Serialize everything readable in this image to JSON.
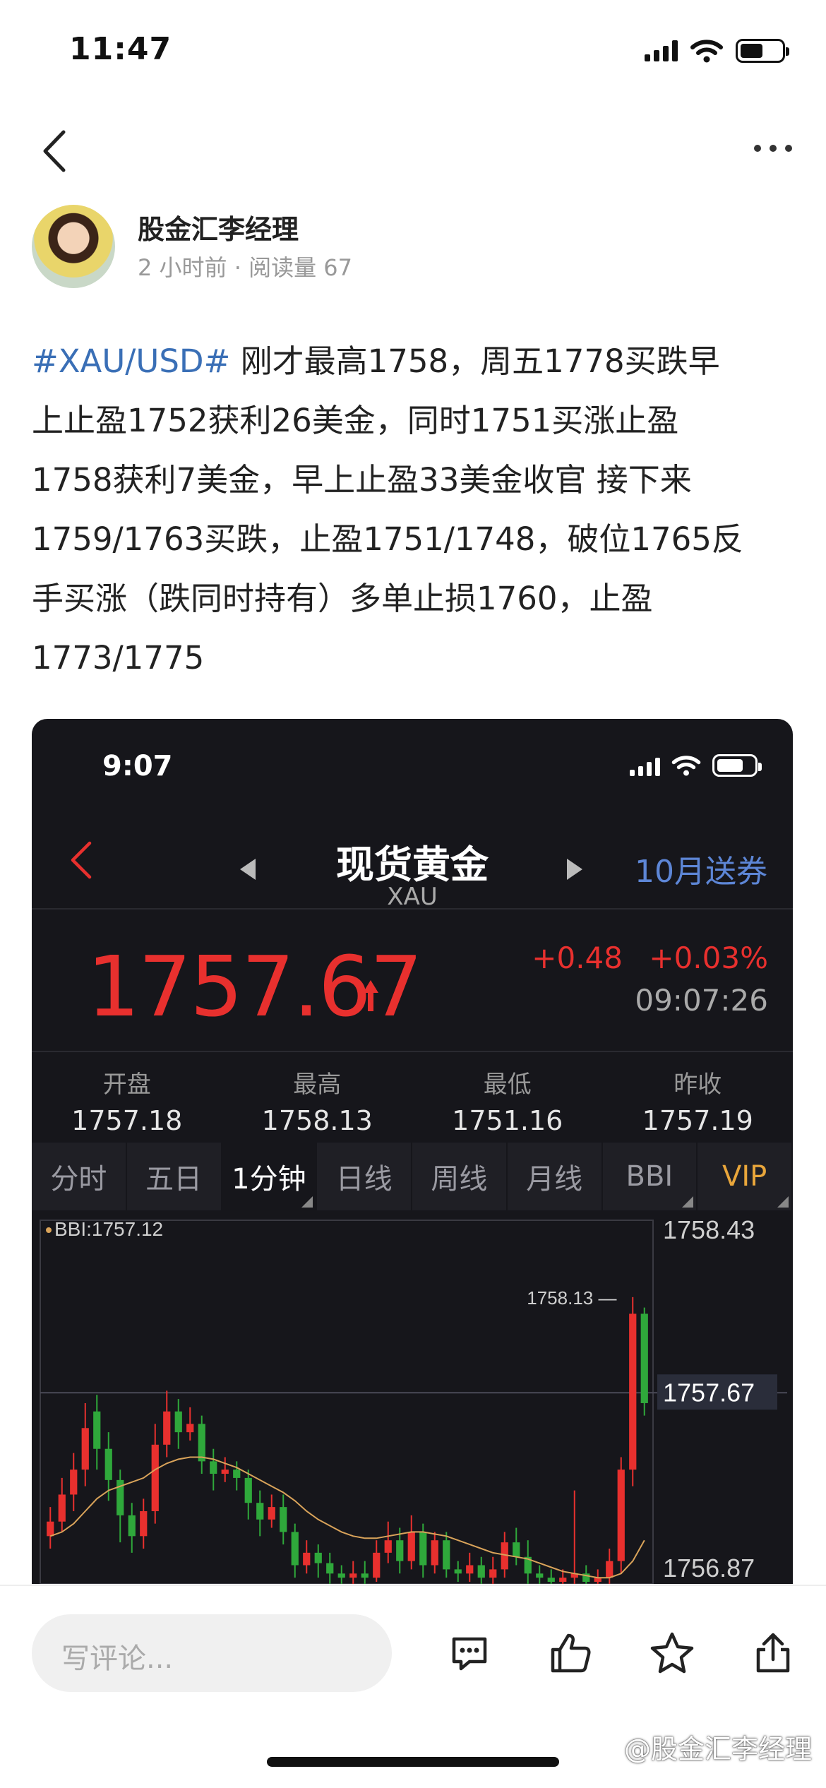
{
  "status_bar": {
    "time": "11:47",
    "icons": [
      "signal-icon",
      "wifi-icon",
      "battery-icon"
    ]
  },
  "nav": {
    "icons": [
      "back-arrow-icon",
      "more-icon"
    ]
  },
  "author": {
    "name": "股金汇李经理",
    "time_ago": "2 小时前",
    "separator": "·",
    "read_label": "阅读量",
    "read_count": "67"
  },
  "post": {
    "tag": "#XAU/USD#",
    "lines": [
      " 刚才最高1758，周五1778买跌早",
      "上止盈1752获利26美金，同时1751买涨止盈",
      "1758获利7美金，早上止盈33美金收官 接下来",
      "1759/1763买跌，止盈1751/1748，破位1765反",
      "手买涨（跌同时持有）多单止损1760，止盈",
      "1773/1775"
    ]
  },
  "screenshot": {
    "time": "9:07",
    "title": "现货黄金",
    "symbol": "XAU",
    "promo": "10月送券",
    "price": "1757.67",
    "change": "+0.48",
    "change_pct": "+0.03%",
    "clock": "09:07:26",
    "stats": [
      {
        "label": "开盘",
        "value": "1757.18"
      },
      {
        "label": "最高",
        "value": "1758.13"
      },
      {
        "label": "最低",
        "value": "1751.16"
      },
      {
        "label": "昨收",
        "value": "1757.19"
      }
    ],
    "tabs": [
      "分时",
      "五日",
      "1分钟",
      "日线",
      "周线",
      "月线",
      "BBI",
      "VIP"
    ],
    "active_tab": "1分钟",
    "colors": {
      "up": "#e8302e",
      "down": "#2fa83b",
      "bbi": "#d9a35a",
      "link": "#5d86d6",
      "vip": "#e9a63b"
    }
  },
  "chart_data": {
    "type": "candlestick",
    "indicator_label": "BBI:1757.12",
    "y_ticks": [
      "1758.43",
      "1757.67",
      "1756.87"
    ],
    "ylim": [
      1756.75,
      1758.5
    ],
    "high_label": "1758.13",
    "current_label": "1757.67",
    "candles": [
      {
        "o": 1756.98,
        "c": 1757.05,
        "h": 1757.12,
        "l": 1756.92
      },
      {
        "o": 1757.05,
        "c": 1757.18,
        "h": 1757.26,
        "l": 1757.0
      },
      {
        "o": 1757.18,
        "c": 1757.3,
        "h": 1757.38,
        "l": 1757.1
      },
      {
        "o": 1757.3,
        "c": 1757.5,
        "h": 1757.62,
        "l": 1757.22
      },
      {
        "o": 1757.58,
        "c": 1757.4,
        "h": 1757.66,
        "l": 1757.3
      },
      {
        "o": 1757.4,
        "c": 1757.25,
        "h": 1757.48,
        "l": 1757.15
      },
      {
        "o": 1757.25,
        "c": 1757.08,
        "h": 1757.3,
        "l": 1756.95
      },
      {
        "o": 1757.08,
        "c": 1756.98,
        "h": 1757.14,
        "l": 1756.9
      },
      {
        "o": 1756.98,
        "c": 1757.1,
        "h": 1757.16,
        "l": 1756.92
      },
      {
        "o": 1757.1,
        "c": 1757.42,
        "h": 1757.52,
        "l": 1757.04
      },
      {
        "o": 1757.42,
        "c": 1757.58,
        "h": 1757.68,
        "l": 1757.36
      },
      {
        "o": 1757.58,
        "c": 1757.48,
        "h": 1757.64,
        "l": 1757.4
      },
      {
        "o": 1757.48,
        "c": 1757.52,
        "h": 1757.6,
        "l": 1757.44
      },
      {
        "o": 1757.52,
        "c": 1757.34,
        "h": 1757.56,
        "l": 1757.28
      },
      {
        "o": 1757.34,
        "c": 1757.28,
        "h": 1757.4,
        "l": 1757.2
      },
      {
        "o": 1757.28,
        "c": 1757.3,
        "h": 1757.36,
        "l": 1757.24
      },
      {
        "o": 1757.3,
        "c": 1757.26,
        "h": 1757.34,
        "l": 1757.2
      },
      {
        "o": 1757.26,
        "c": 1757.14,
        "h": 1757.3,
        "l": 1757.06
      },
      {
        "o": 1757.14,
        "c": 1757.06,
        "h": 1757.2,
        "l": 1756.98
      },
      {
        "o": 1757.06,
        "c": 1757.12,
        "h": 1757.18,
        "l": 1757.02
      },
      {
        "o": 1757.12,
        "c": 1757.0,
        "h": 1757.18,
        "l": 1756.94
      },
      {
        "o": 1757.0,
        "c": 1756.84,
        "h": 1757.04,
        "l": 1756.78
      },
      {
        "o": 1756.84,
        "c": 1756.9,
        "h": 1756.96,
        "l": 1756.8
      },
      {
        "o": 1756.9,
        "c": 1756.85,
        "h": 1756.94,
        "l": 1756.78
      },
      {
        "o": 1756.85,
        "c": 1756.8,
        "h": 1756.9,
        "l": 1756.75
      },
      {
        "o": 1756.8,
        "c": 1756.78,
        "h": 1756.84,
        "l": 1756.75
      },
      {
        "o": 1756.78,
        "c": 1756.8,
        "h": 1756.86,
        "l": 1756.75
      },
      {
        "o": 1756.8,
        "c": 1756.78,
        "h": 1756.86,
        "l": 1756.75
      },
      {
        "o": 1756.78,
        "c": 1756.9,
        "h": 1756.96,
        "l": 1756.76
      },
      {
        "o": 1756.9,
        "c": 1756.96,
        "h": 1757.05,
        "l": 1756.85
      },
      {
        "o": 1756.96,
        "c": 1756.86,
        "h": 1757.02,
        "l": 1756.8
      },
      {
        "o": 1756.86,
        "c": 1757.0,
        "h": 1757.08,
        "l": 1756.82
      },
      {
        "o": 1757.0,
        "c": 1756.84,
        "h": 1757.04,
        "l": 1756.78
      },
      {
        "o": 1756.84,
        "c": 1756.96,
        "h": 1757.0,
        "l": 1756.8
      },
      {
        "o": 1756.96,
        "c": 1756.82,
        "h": 1757.0,
        "l": 1756.78
      },
      {
        "o": 1756.82,
        "c": 1756.8,
        "h": 1756.86,
        "l": 1756.76
      },
      {
        "o": 1756.8,
        "c": 1756.84,
        "h": 1756.9,
        "l": 1756.76
      },
      {
        "o": 1756.84,
        "c": 1756.78,
        "h": 1756.88,
        "l": 1756.75
      },
      {
        "o": 1756.78,
        "c": 1756.82,
        "h": 1756.88,
        "l": 1756.75
      },
      {
        "o": 1756.82,
        "c": 1756.95,
        "h": 1757.0,
        "l": 1756.78
      },
      {
        "o": 1756.95,
        "c": 1756.88,
        "h": 1757.02,
        "l": 1756.84
      },
      {
        "o": 1756.88,
        "c": 1756.8,
        "h": 1756.96,
        "l": 1756.75
      },
      {
        "o": 1756.8,
        "c": 1756.78,
        "h": 1756.84,
        "l": 1756.75
      },
      {
        "o": 1756.78,
        "c": 1756.76,
        "h": 1756.82,
        "l": 1756.75
      },
      {
        "o": 1756.76,
        "c": 1756.78,
        "h": 1756.82,
        "l": 1756.75
      },
      {
        "o": 1756.78,
        "c": 1756.8,
        "h": 1757.2,
        "l": 1756.75
      },
      {
        "o": 1756.8,
        "c": 1756.76,
        "h": 1756.84,
        "l": 1756.75
      },
      {
        "o": 1756.76,
        "c": 1756.78,
        "h": 1756.82,
        "l": 1756.75
      },
      {
        "o": 1756.78,
        "c": 1756.86,
        "h": 1756.92,
        "l": 1756.75
      },
      {
        "o": 1756.86,
        "c": 1757.3,
        "h": 1757.36,
        "l": 1756.8
      },
      {
        "o": 1757.3,
        "c": 1758.05,
        "h": 1758.13,
        "l": 1757.22
      },
      {
        "o": 1758.05,
        "c": 1757.62,
        "h": 1758.08,
        "l": 1757.56
      }
    ],
    "bbi": [
      1756.98,
      1757.0,
      1757.04,
      1757.1,
      1757.16,
      1757.2,
      1757.22,
      1757.24,
      1757.26,
      1757.3,
      1757.33,
      1757.35,
      1757.36,
      1757.36,
      1757.35,
      1757.33,
      1757.31,
      1757.28,
      1757.25,
      1757.22,
      1757.19,
      1757.15,
      1757.1,
      1757.06,
      1757.03,
      1757.0,
      1756.98,
      1756.97,
      1756.97,
      1756.98,
      1756.99,
      1757.0,
      1757.0,
      1756.99,
      1756.98,
      1756.96,
      1756.94,
      1756.92,
      1756.9,
      1756.89,
      1756.88,
      1756.87,
      1756.85,
      1756.83,
      1756.81,
      1756.8,
      1756.79,
      1756.78,
      1756.78,
      1756.8,
      1756.86,
      1756.96
    ]
  },
  "bottom_bar": {
    "comment_placeholder": "写评论...",
    "icons": [
      "comment-icon",
      "like-icon",
      "favorite-icon",
      "share-icon"
    ],
    "watermark": "@股金汇李经理"
  }
}
